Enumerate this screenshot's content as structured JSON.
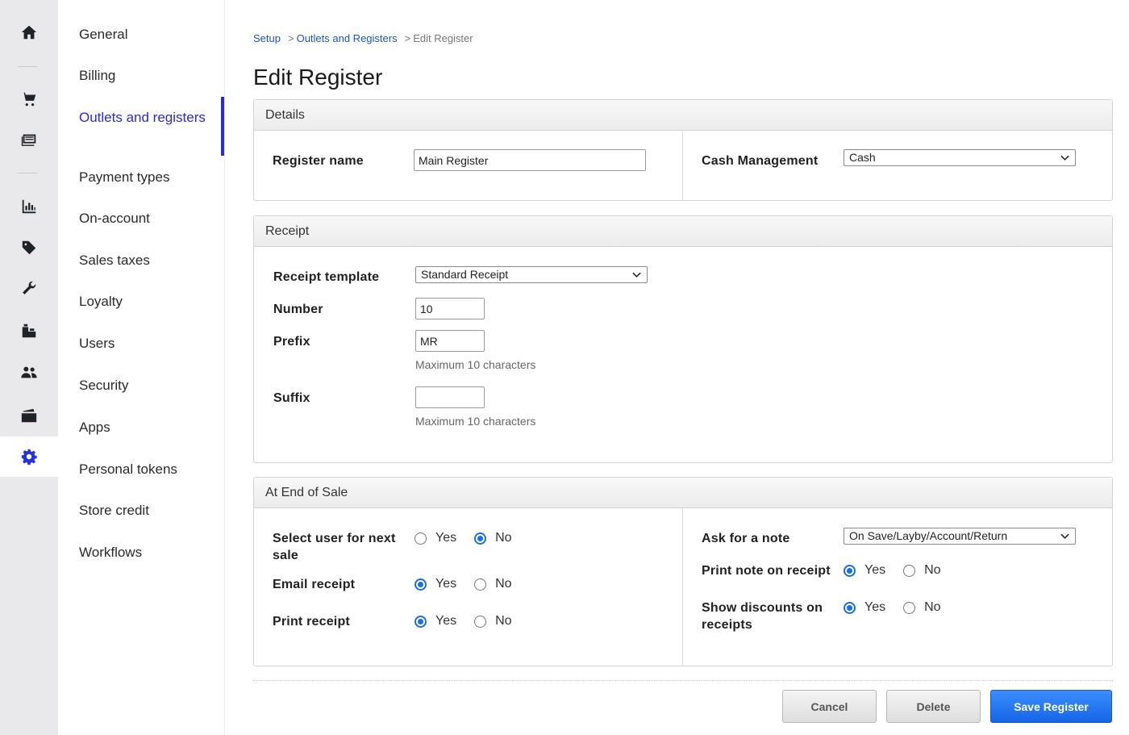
{
  "rail": {
    "icons": [
      "home-icon",
      "cart-icon",
      "register-icon",
      "reports-icon",
      "tag-icon",
      "wrench-icon",
      "inventory-icon",
      "customers-icon",
      "cash-drawer-icon",
      "settings-icon"
    ]
  },
  "subnav": {
    "items": [
      {
        "label": "General"
      },
      {
        "label": "Billing"
      },
      {
        "label": "Outlets and registers",
        "active": true
      },
      {
        "label": "Payment types"
      },
      {
        "label": "On-account"
      },
      {
        "label": "Sales taxes"
      },
      {
        "label": "Loyalty"
      },
      {
        "label": "Users"
      },
      {
        "label": "Security"
      },
      {
        "label": "Apps"
      },
      {
        "label": "Personal tokens"
      },
      {
        "label": "Store credit"
      },
      {
        "label": "Workflows"
      }
    ]
  },
  "breadcrumb": {
    "items": [
      "Setup",
      "Outlets and Registers",
      "Edit Register"
    ],
    "separator": ">"
  },
  "page": {
    "title": "Edit Register"
  },
  "details": {
    "heading": "Details",
    "register_name_label": "Register name",
    "register_name_value": "Main Register",
    "cash_management_label": "Cash Management",
    "cash_management_value": "Cash"
  },
  "receipt": {
    "heading": "Receipt",
    "template_label": "Receipt template",
    "template_value": "Standard Receipt",
    "number_label": "Number",
    "number_value": "10",
    "prefix_label": "Prefix",
    "prefix_value": "MR",
    "prefix_hint": "Maximum 10 characters",
    "suffix_label": "Suffix",
    "suffix_value": "",
    "suffix_hint": "Maximum 10 characters"
  },
  "end_of_sale": {
    "heading": "At End of Sale",
    "yes_label": "Yes",
    "no_label": "No",
    "select_user_label": "Select user for next sale",
    "select_user_value": "No",
    "email_receipt_label": "Email receipt",
    "email_receipt_value": "Yes",
    "print_receipt_label": "Print receipt",
    "print_receipt_value": "Yes",
    "ask_note_label": "Ask for a note",
    "ask_note_value": "On Save/Layby/Account/Return",
    "print_note_label": "Print note on receipt",
    "print_note_value": "Yes",
    "show_discounts_label": "Show discounts on receipts",
    "show_discounts_value": "Yes"
  },
  "actions": {
    "cancel_label": "Cancel",
    "delete_label": "Delete",
    "save_label": "Save Register"
  },
  "colors": {
    "accent": "#2a2ad6",
    "primary_button": "#1a6fe0",
    "link": "#1a56c9"
  }
}
